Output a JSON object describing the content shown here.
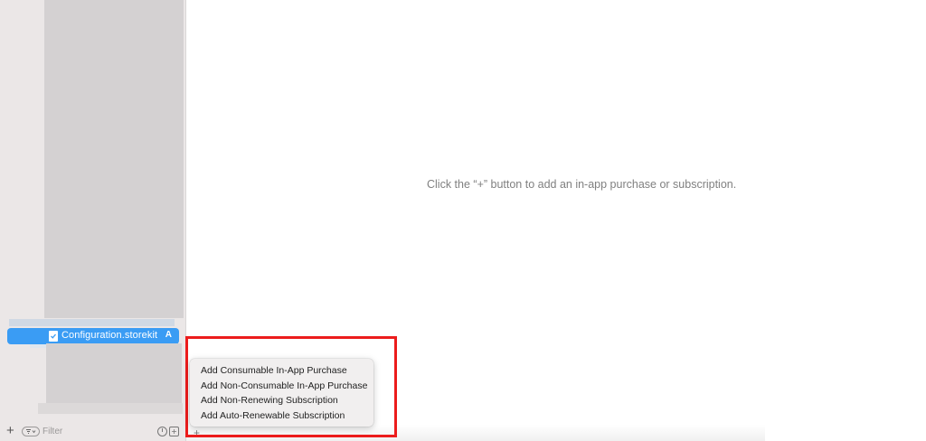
{
  "sidebar": {
    "selected_file": {
      "name": "Configuration.storekit",
      "badge": "A",
      "icon": "storekit-file-icon"
    },
    "footer": {
      "add_symbol": "+",
      "filter_placeholder": "Filter"
    }
  },
  "editor": {
    "empty_message": "Click the “+” button to add an in-app purchase or subscription.",
    "add_symbol": "+"
  },
  "add_menu": {
    "items": [
      "Add Consumable In-App Purchase",
      "Add Non-Consumable In-App Purchase",
      "Add Non-Renewing Subscription",
      "Add Auto-Renewable Subscription"
    ]
  },
  "colors": {
    "selection": "#3a9cf4",
    "highlight": "#ec1c1c",
    "sidebar_bg": "#ebe7e7"
  }
}
